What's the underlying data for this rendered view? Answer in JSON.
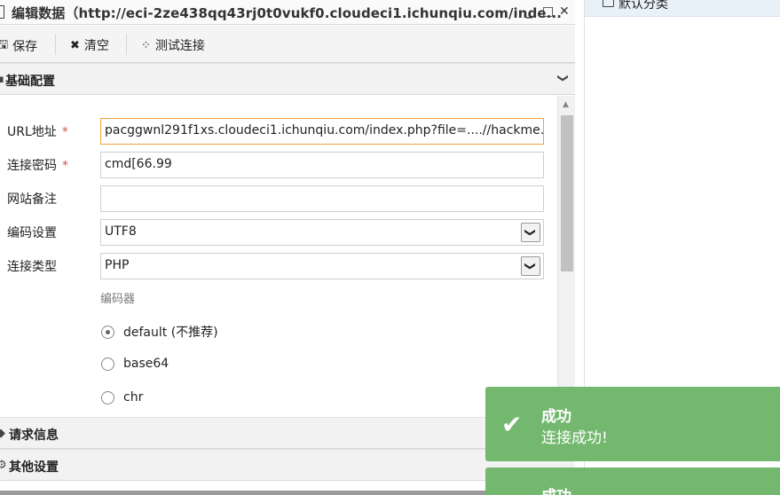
{
  "window": {
    "title": "编辑数据（http://eci-2ze438qq43rj0t0vukf0.cloudeci1.ichunqiu.com/inde...",
    "min_glyph": "_",
    "max_glyph": "□",
    "close_glyph": "✕"
  },
  "toolbar": {
    "save_label": "保存",
    "clear_label": "清空",
    "test_label": "测试连接"
  },
  "sections": {
    "basic": "基础配置",
    "request": "请求信息",
    "other": "其他设置"
  },
  "form": {
    "url_label": "URL地址",
    "url_value": "pacggwnl291f1xs.cloudeci1.ichunqiu.com/index.php?file=....//hackme.php",
    "password_label": "连接密码",
    "password_value": "cmd[66.99",
    "note_label": "网站备注",
    "note_value": "",
    "encoding_label": "编码设置",
    "encoding_value": "UTF8",
    "type_label": "连接类型",
    "type_value": "PHP",
    "required_mark": "*",
    "encoder_heading": "编码器",
    "encoders": [
      {
        "label": "default (不推荐)",
        "selected": true
      },
      {
        "label": "base64",
        "selected": false
      },
      {
        "label": "chr",
        "selected": false
      }
    ]
  },
  "tree": {
    "item_label": "默认分类"
  },
  "toasts": [
    {
      "title": "成功",
      "message": "连接成功!"
    },
    {
      "title": "成功"
    }
  ],
  "icons": {
    "save": "save-icon",
    "clear": "x-icon",
    "test": "spinner-icon",
    "section_chevron": "chevron-down-icon",
    "toast": "checkmark-icon"
  },
  "colors": {
    "toast_bg": "#74b870",
    "required": "#d9534f",
    "focus_border": "#f0a040"
  }
}
